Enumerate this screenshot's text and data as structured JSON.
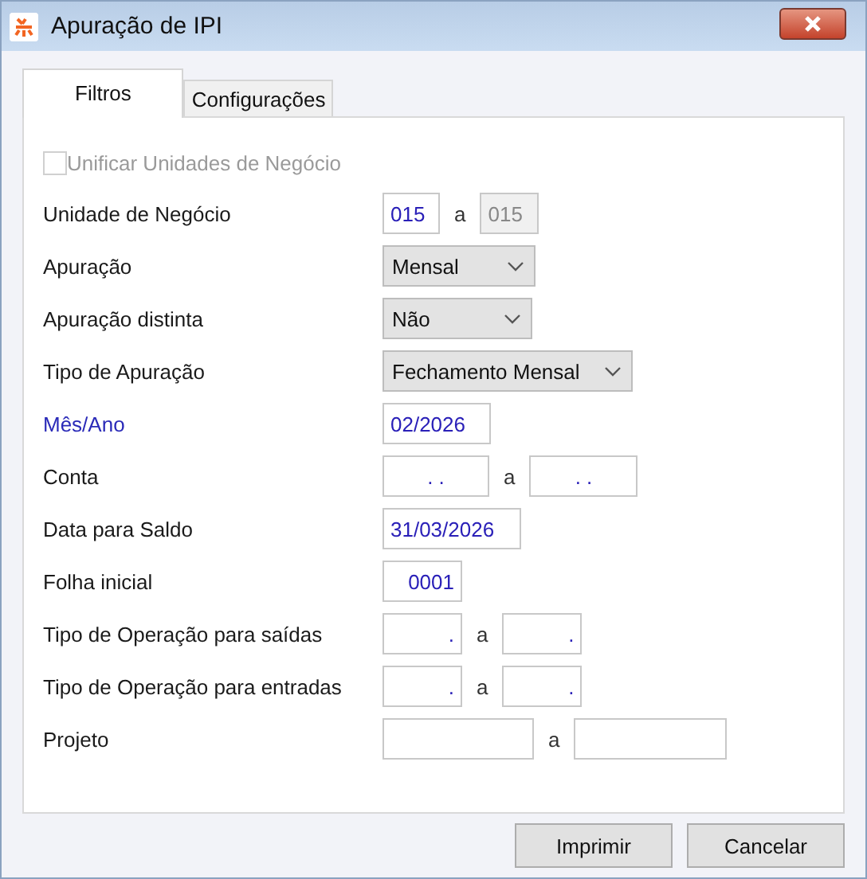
{
  "window": {
    "title": "Apuração de IPI"
  },
  "tabs": [
    {
      "label": "Filtros",
      "selected": true
    },
    {
      "label": "Configurações",
      "selected": false
    }
  ],
  "unify_checkbox": {
    "label": "Unificar Unidades de Negócio",
    "checked": false,
    "disabled": true
  },
  "rows": [
    {
      "label": "Unidade de Negócio",
      "required": false,
      "separator": "a",
      "fields": [
        {
          "kind": "text",
          "value": "015",
          "disabled": false
        },
        {
          "kind": "text",
          "value": "015",
          "disabled": true
        }
      ]
    },
    {
      "label": "Apuração",
      "required": false,
      "fields": [
        {
          "kind": "select",
          "value": "Mensal"
        }
      ]
    },
    {
      "label": "Apuração distinta",
      "required": false,
      "fields": [
        {
          "kind": "select",
          "value": "Não"
        }
      ]
    },
    {
      "label": "Tipo de Apuração",
      "required": false,
      "fields": [
        {
          "kind": "select",
          "value": "Fechamento Mensal"
        }
      ]
    },
    {
      "label": "Mês/Ano",
      "required": true,
      "fields": [
        {
          "kind": "text",
          "value": "02/2026",
          "disabled": false
        }
      ]
    },
    {
      "label": "Conta",
      "required": false,
      "separator": "a",
      "fields": [
        {
          "kind": "text",
          "value": ". .",
          "disabled": false
        },
        {
          "kind": "text",
          "value": ". .",
          "disabled": false
        }
      ]
    },
    {
      "label": "Data para Saldo",
      "required": false,
      "fields": [
        {
          "kind": "text",
          "value": "31/03/2026",
          "disabled": false
        }
      ]
    },
    {
      "label": "Folha inicial",
      "required": false,
      "fields": [
        {
          "kind": "text",
          "value": "0001",
          "disabled": false
        }
      ]
    },
    {
      "label": "Tipo de Operação para saídas",
      "required": false,
      "separator": "a",
      "fields": [
        {
          "kind": "text",
          "value": ".",
          "disabled": false
        },
        {
          "kind": "text",
          "value": ".",
          "disabled": false
        }
      ]
    },
    {
      "label": "Tipo de Operação para entradas",
      "required": false,
      "separator": "a",
      "fields": [
        {
          "kind": "text",
          "value": ".",
          "disabled": false
        },
        {
          "kind": "text",
          "value": ".",
          "disabled": false
        }
      ]
    },
    {
      "label": "Projeto",
      "required": false,
      "separator": "a",
      "fields": [
        {
          "kind": "text",
          "disabled": false
        },
        {
          "kind": "text",
          "disabled": false
        }
      ]
    }
  ],
  "buttons": [
    {
      "label": "Imprimir"
    },
    {
      "label": "Cancelar"
    }
  ]
}
